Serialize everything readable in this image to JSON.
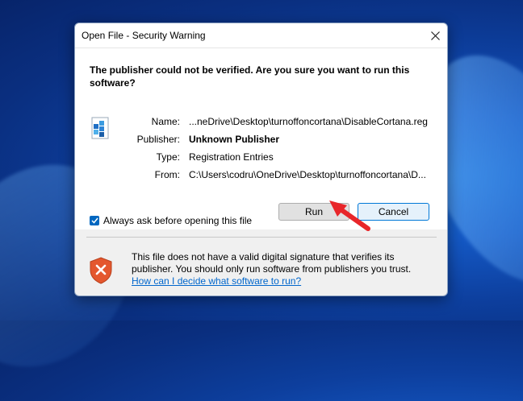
{
  "dialog": {
    "title": "Open File - Security Warning",
    "headline": "The publisher could not be verified.  Are you sure you want to run this software?",
    "fields": [
      {
        "label": "Name:",
        "value": "...neDrive\\Desktop\\turnoffoncortana\\DisableCortana.reg"
      },
      {
        "label": "Publisher:",
        "value": "Unknown Publisher"
      },
      {
        "label": "Type:",
        "value": "Registration Entries"
      },
      {
        "label": "From:",
        "value": "C:\\Users\\codru\\OneDrive\\Desktop\\turnoffoncortana\\D..."
      }
    ],
    "run_label": "Run",
    "cancel_label": "Cancel",
    "checkbox_label": "Always ask before opening this file",
    "checkbox_checked": true,
    "warning_text": "This file does not have a valid digital signature that verifies its publisher.  You should only run software from publishers you trust.",
    "warning_link": "How can I decide what software to run?"
  },
  "colors": {
    "accent": "#0067c0",
    "arrow": "#e8262a",
    "shield": "#e4572e"
  },
  "icons": {
    "file": "registry-file-icon",
    "close": "close-icon",
    "warning": "warning-shield-icon",
    "annotation": "red-arrow-icon"
  }
}
